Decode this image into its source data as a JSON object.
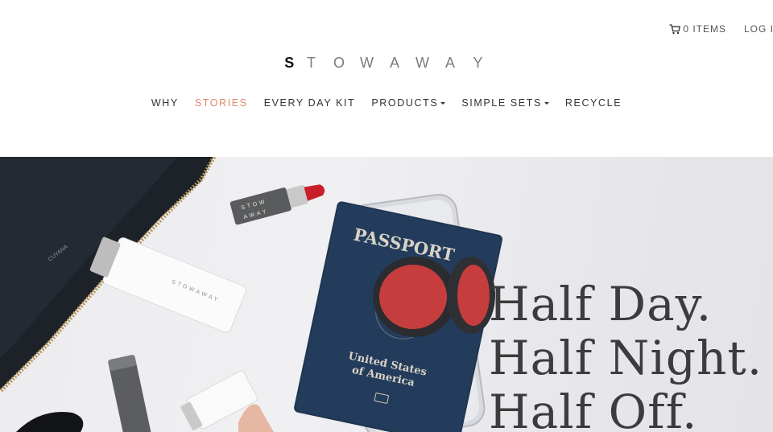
{
  "header": {
    "cart_label": "0 ITEMS",
    "login_label": "LOG IN",
    "logo_letters": [
      "S",
      "T",
      "O",
      "W",
      "A",
      "W",
      "A",
      "Y"
    ]
  },
  "nav": {
    "items": [
      {
        "label": "WHY",
        "active": false,
        "dropdown": false
      },
      {
        "label": "STORIES",
        "active": true,
        "dropdown": false
      },
      {
        "label": "EVERY DAY KIT",
        "active": false,
        "dropdown": false
      },
      {
        "label": "PRODUCTS",
        "active": false,
        "dropdown": true
      },
      {
        "label": "SIMPLE SETS",
        "active": false,
        "dropdown": true
      },
      {
        "label": "RECYCLE",
        "active": false,
        "dropdown": false
      }
    ],
    "active_color": "#e1866a"
  },
  "hero": {
    "headline": [
      "Half Day.",
      "Half Night.",
      "Half Off."
    ],
    "passport_text": "PASSPORT",
    "passport_country_line1": "United States",
    "passport_country_line2": "of America",
    "product_brand": "STOWAWAY"
  },
  "icons": {
    "cart": "cart-icon",
    "caret": "caret-down-icon"
  }
}
